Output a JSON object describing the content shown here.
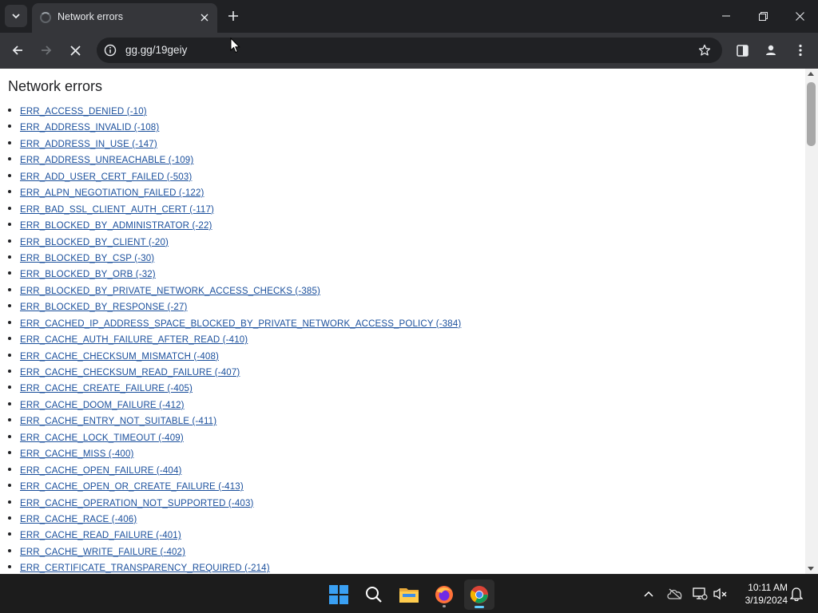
{
  "tab": {
    "title": "Network errors"
  },
  "omnibox": {
    "url": "gg.gg/19geiy"
  },
  "page": {
    "heading": "Network errors",
    "errors": [
      "ERR_ACCESS_DENIED (-10)",
      "ERR_ADDRESS_INVALID (-108)",
      "ERR_ADDRESS_IN_USE (-147)",
      "ERR_ADDRESS_UNREACHABLE (-109)",
      "ERR_ADD_USER_CERT_FAILED (-503)",
      "ERR_ALPN_NEGOTIATION_FAILED (-122)",
      "ERR_BAD_SSL_CLIENT_AUTH_CERT (-117)",
      "ERR_BLOCKED_BY_ADMINISTRATOR (-22)",
      "ERR_BLOCKED_BY_CLIENT (-20)",
      "ERR_BLOCKED_BY_CSP (-30)",
      "ERR_BLOCKED_BY_ORB (-32)",
      "ERR_BLOCKED_BY_PRIVATE_NETWORK_ACCESS_CHECKS (-385)",
      "ERR_BLOCKED_BY_RESPONSE (-27)",
      "ERR_CACHED_IP_ADDRESS_SPACE_BLOCKED_BY_PRIVATE_NETWORK_ACCESS_POLICY (-384)",
      "ERR_CACHE_AUTH_FAILURE_AFTER_READ (-410)",
      "ERR_CACHE_CHECKSUM_MISMATCH (-408)",
      "ERR_CACHE_CHECKSUM_READ_FAILURE (-407)",
      "ERR_CACHE_CREATE_FAILURE (-405)",
      "ERR_CACHE_DOOM_FAILURE (-412)",
      "ERR_CACHE_ENTRY_NOT_SUITABLE (-411)",
      "ERR_CACHE_LOCK_TIMEOUT (-409)",
      "ERR_CACHE_MISS (-400)",
      "ERR_CACHE_OPEN_FAILURE (-404)",
      "ERR_CACHE_OPEN_OR_CREATE_FAILURE (-413)",
      "ERR_CACHE_OPERATION_NOT_SUPPORTED (-403)",
      "ERR_CACHE_RACE (-406)",
      "ERR_CACHE_READ_FAILURE (-401)",
      "ERR_CACHE_WRITE_FAILURE (-402)",
      "ERR_CERTIFICATE_TRANSPARENCY_REQUIRED (-214)"
    ]
  },
  "taskbar": {
    "time": "10:11 AM",
    "date": "3/19/2024"
  },
  "colors": {
    "link": "#1a4f9c",
    "chrome_dark": "#202124",
    "chrome_toolbar": "#35363a",
    "taskbar": "#1c1c1c",
    "accent": "#60cdff"
  }
}
